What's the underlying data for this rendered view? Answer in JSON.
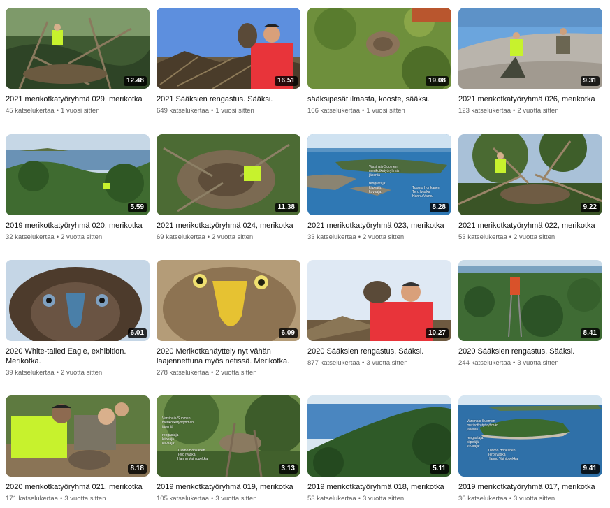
{
  "videos": [
    {
      "title": "2021 merikotkatyöryhmä 029, merikotka",
      "views": "45 katselukertaa",
      "age": "1 vuosi sitten",
      "duration": "12.48"
    },
    {
      "title": "2021 Sääksien rengastus. Sääksi.",
      "views": "649 katselukertaa",
      "age": "1 vuosi sitten",
      "duration": "16.51"
    },
    {
      "title": "sääksipesät ilmasta, kooste, sääksi.",
      "views": "166 katselukertaa",
      "age": "1 vuosi sitten",
      "duration": "19.08"
    },
    {
      "title": "2021 merikotkatyöryhmä 026, merikotka",
      "views": "123 katselukertaa",
      "age": "2 vuotta sitten",
      "duration": "9.31"
    },
    {
      "title": "2019 merikotkatyöryhmä 020, merikotka",
      "views": "32 katselukertaa",
      "age": "2 vuotta sitten",
      "duration": "5.59"
    },
    {
      "title": "2021 merikotkatyöryhmä 024, merikotka",
      "views": "69 katselukertaa",
      "age": "2 vuotta sitten",
      "duration": "11.38"
    },
    {
      "title": "2021 merikotkatyöryhmä 023, merikotka",
      "views": "33 katselukertaa",
      "age": "2 vuotta sitten",
      "duration": "8.28",
      "overlay_left": "Varsinais-Suomen\nmerikotkatyöryhmän\njäseniä\n\nrengastaja:\nkiipeäjä:\nkuvaaja:",
      "overlay_right": "Tuomo Honkanen\nTero Ivaska\nHannu Valmu"
    },
    {
      "title": "2021 merikotkatyöryhmä 022, merikotka",
      "views": "53 katselukertaa",
      "age": "2 vuotta sitten",
      "duration": "9.22"
    },
    {
      "title": "2020 White-tailed Eagle, exhibition. Merikotka.",
      "views": "39 katselukertaa",
      "age": "2 vuotta sitten",
      "duration": "6.01"
    },
    {
      "title": "2020 Merikotkanäyttely nyt vähän laajennettuna myös netissä. Merikotka.",
      "views": "278 katselukertaa",
      "age": "2 vuotta sitten",
      "duration": "6.09"
    },
    {
      "title": "2020 Sääksien rengastus. Sääksi.",
      "views": "877 katselukertaa",
      "age": "3 vuotta sitten",
      "duration": "10.27"
    },
    {
      "title": "2020 Sääksien rengastus. Sääksi.",
      "views": "244 katselukertaa",
      "age": "3 vuotta sitten",
      "duration": "8.41"
    },
    {
      "title": "2020 merikotkatyöryhmä 021, merikotka",
      "views": "171 katselukertaa",
      "age": "3 vuotta sitten",
      "duration": "8.18"
    },
    {
      "title": "2019 merikotkatyöryhmä 019, merikotka",
      "views": "105 katselukertaa",
      "age": "3 vuotta sitten",
      "duration": "3.13",
      "overlay_left": "Varsinais-Suomen\nmerikotkatyöryhmän\njäseniä\n\nrengastaja\nkiipeäjä\nkuvaaja:",
      "overlay_right": "Tuomo Honkanen\nTero Ivaska\nHannu Vainiopekka"
    },
    {
      "title": "2019 merikotkatyöryhmä 018, merikotka",
      "views": "53 katselukertaa",
      "age": "3 vuotta sitten",
      "duration": "5.11"
    },
    {
      "title": "2019 merikotkatyöryhmä 017, merikotka",
      "views": "36 katselukertaa",
      "age": "3 vuotta sitten",
      "duration": "9.41",
      "overlay_left": "Varsinais-Suomen\nmerikotkatyöryhmän\njäseniä\n\nrengastaja:\nkiipeäjä:\nkuvaaja:",
      "overlay_right": "Tuomo Honkanen\nTero Ivaska\nHannu Vainiopekka"
    }
  ],
  "separator": "•"
}
